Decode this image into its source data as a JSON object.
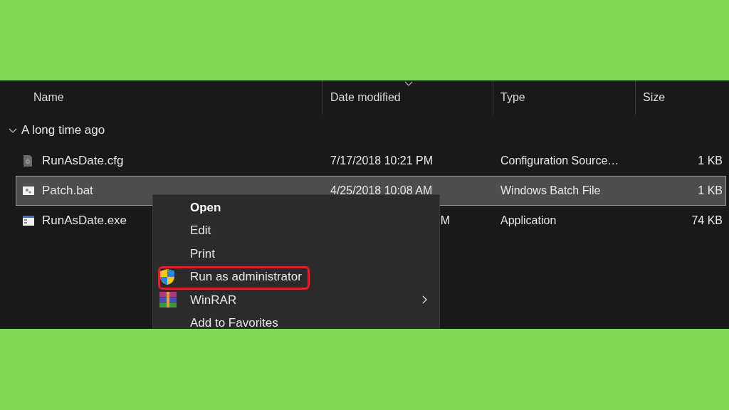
{
  "columns": [
    {
      "label": "Name",
      "sorted": false
    },
    {
      "label": "Date modified",
      "sorted": true
    },
    {
      "label": "Type",
      "sorted": false
    },
    {
      "label": "Size",
      "sorted": false
    }
  ],
  "group": {
    "label": "A long time ago",
    "expanded": true
  },
  "rows": [
    {
      "kind": "config",
      "name": "RunAsDate.cfg",
      "date": "7/17/2018 10:21 PM",
      "type": "Configuration Source…",
      "size": "1 KB",
      "selected": false
    },
    {
      "kind": "batch",
      "name": "Patch.bat",
      "date": "4/25/2018 10:08 AM",
      "type": "Windows Batch File",
      "size": "1 KB",
      "selected": true
    },
    {
      "kind": "app",
      "name": "RunAsDate.exe",
      "date": "M",
      "type": "Application",
      "size": "74 KB",
      "selected": false
    }
  ],
  "context_menu": [
    {
      "kind": "text",
      "label": "Open",
      "default": true,
      "highlighted": false,
      "submenu": false
    },
    {
      "kind": "text",
      "label": "Edit",
      "default": false,
      "highlighted": false,
      "submenu": false
    },
    {
      "kind": "text",
      "label": "Print",
      "default": false,
      "highlighted": false,
      "submenu": false
    },
    {
      "kind": "admin",
      "label": "Run as administrator",
      "default": false,
      "highlighted": true,
      "submenu": false
    },
    {
      "kind": "archive",
      "label": "WinRAR",
      "default": false,
      "highlighted": false,
      "submenu": true
    },
    {
      "kind": "text",
      "label": "Add to Favorites",
      "default": false,
      "highlighted": false,
      "submenu": false
    }
  ]
}
